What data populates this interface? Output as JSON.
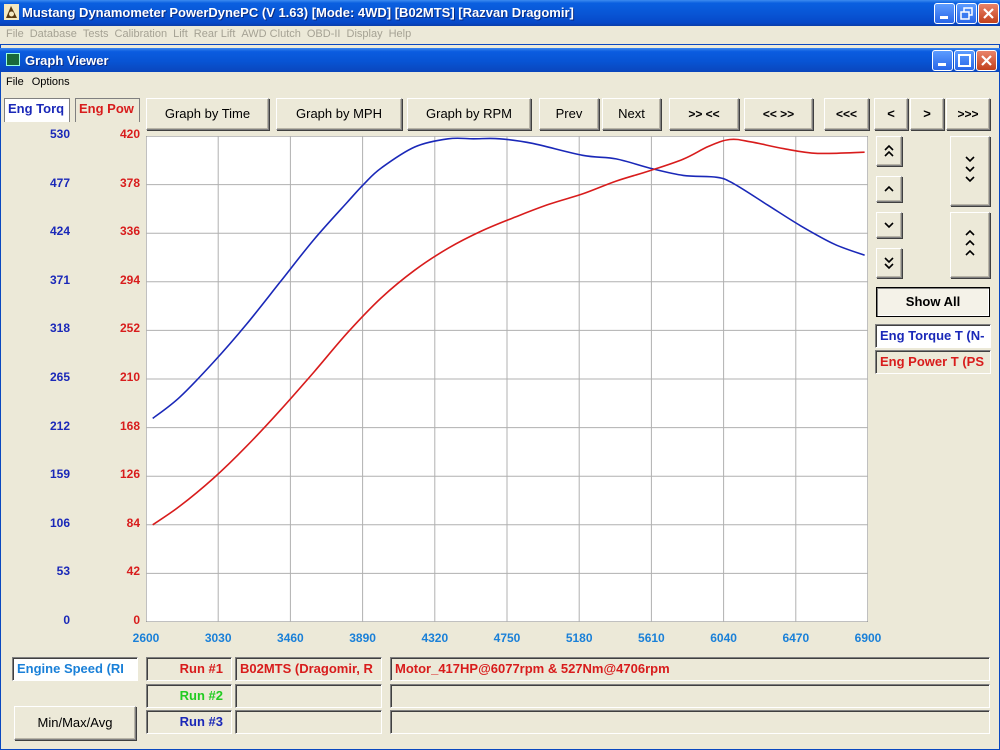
{
  "app": {
    "title": "Mustang Dynamometer PowerDynePC (V 1.63) [Mode: 4WD] [B02MTS] [Razvan Dragomir]",
    "menu": [
      "File",
      "Database",
      "Tests",
      "Calibration",
      "Lift",
      "Rear Lift",
      "AWD Clutch",
      "OBD-II",
      "Display",
      "Help"
    ]
  },
  "viewer": {
    "title": "Graph Viewer",
    "menu": [
      "File",
      "Options"
    ]
  },
  "tabs": {
    "torque": "Eng Torq",
    "power": "Eng Pow"
  },
  "toolbar": {
    "by_time": "Graph by Time",
    "by_mph": "Graph by MPH",
    "by_rpm": "Graph by RPM",
    "prev": "Prev",
    "next": "Next",
    "zoom_in": ">> <<",
    "zoom_out": "<< >>",
    "scroll_far_left": "<<<",
    "scroll_left": "<",
    "scroll_right": ">",
    "scroll_far_right": ">>>"
  },
  "side": {
    "show_all": "Show All",
    "legend_torque": "Eng Torque T (N-",
    "legend_power": "Eng Power T (PS"
  },
  "bottom": {
    "x_channel": "Engine Speed (RI",
    "minmax": "Min/Max/Avg",
    "runs": [
      {
        "label": "Run #1",
        "color": "#d81c1c",
        "vehicle": "B02MTS (Dragomir, R",
        "note": "Motor_417HP@6077rpm & 527Nm@4706rpm"
      },
      {
        "label": "Run #2",
        "color": "#22cc22",
        "vehicle": "",
        "note": ""
      },
      {
        "label": "Run #3",
        "color": "#1a28b8",
        "vehicle": "",
        "note": ""
      }
    ]
  },
  "colors": {
    "torque": "#1a28b8",
    "power": "#d81c1c",
    "xaxis": "#1a80d8"
  },
  "chart_data": {
    "type": "line",
    "xlabel": "",
    "ylabel": "",
    "xlim": [
      2600,
      6900
    ],
    "x_ticks": [
      2600,
      3030,
      3460,
      3890,
      4320,
      4750,
      5180,
      5610,
      6040,
      6470,
      6900
    ],
    "left_axis": {
      "ylim": [
        0,
        530
      ],
      "ticks": [
        530,
        477,
        424,
        371,
        318,
        265,
        212,
        159,
        106,
        53,
        0
      ],
      "color": "#1a28b8"
    },
    "right_axis": {
      "ylim": [
        0,
        420
      ],
      "ticks": [
        420,
        378,
        336,
        294,
        252,
        210,
        168,
        126,
        84,
        42,
        0
      ],
      "color": "#d81c1c"
    },
    "grid": true,
    "series": [
      {
        "axis": "left",
        "color": "#1a28b8",
        "x": [
          2640,
          2800,
          3000,
          3200,
          3400,
          3600,
          3800,
          3900,
          4000,
          4200,
          4400,
          4550,
          4706,
          4900,
          5200,
          5400,
          5600,
          5800,
          6000,
          6100,
          6300,
          6500,
          6700,
          6880
        ],
        "y": [
          222,
          245,
          283,
          325,
          371,
          417,
          458,
          478,
          495,
          518,
          527,
          527,
          527,
          522,
          509,
          505,
          495,
          487,
          485,
          478,
          455,
          432,
          412,
          400
        ]
      },
      {
        "axis": "right",
        "color": "#d81c1c",
        "x": [
          2640,
          2800,
          3000,
          3200,
          3400,
          3600,
          3800,
          4000,
          4200,
          4400,
          4600,
          4800,
          5000,
          5200,
          5400,
          5600,
          5800,
          5950,
          6077,
          6200,
          6400,
          6600,
          6880
        ],
        "y": [
          84,
          100,
          124,
          152,
          183,
          216,
          250,
          280,
          304,
          323,
          338,
          350,
          361,
          370,
          381,
          390,
          400,
          411,
          417,
          415,
          409,
          405,
          406
        ]
      }
    ]
  }
}
